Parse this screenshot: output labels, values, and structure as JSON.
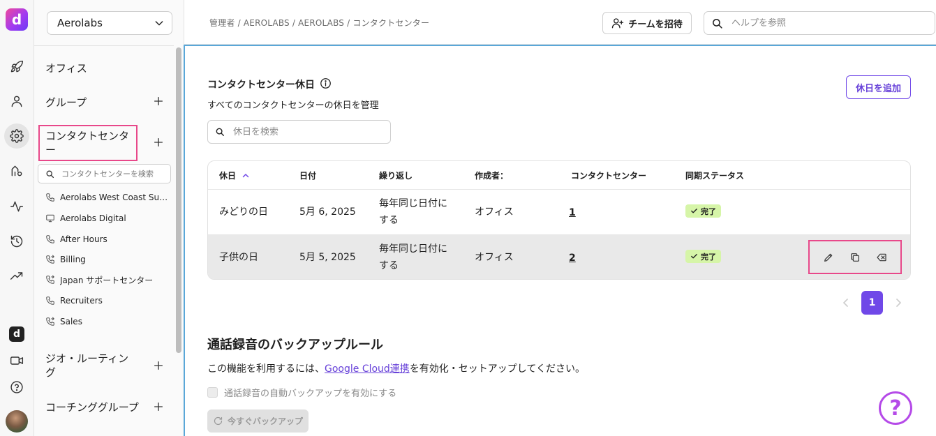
{
  "rail": {
    "logo_letter": "d",
    "badge_letter": "d"
  },
  "sidebar": {
    "company": "Aerolabs",
    "sections": {
      "office": "オフィス",
      "groups": "グループ",
      "contact_center": "コンタクトセンター",
      "geo_routing": "ジオ・ルーティング",
      "coaching": "コーチンググループ"
    },
    "cc_search_placeholder": "コンタクトセンターを検索",
    "cc_items": [
      {
        "label": "Aerolabs West Coast Supp...",
        "icon": "phone-icon"
      },
      {
        "label": "Aerolabs Digital",
        "icon": "monitor-icon"
      },
      {
        "label": "After Hours",
        "icon": "phone-icon"
      },
      {
        "label": "Billing",
        "icon": "phone-forward-icon"
      },
      {
        "label": "Japan サポートセンター",
        "icon": "phone-forward-icon"
      },
      {
        "label": "Recruiters",
        "icon": "phone-icon"
      },
      {
        "label": "Sales",
        "icon": "phone-forward-icon"
      }
    ]
  },
  "header": {
    "breadcrumb": "管理者 / AEROLABS / AEROLABS / コンタクトセンター",
    "invite_label": "チームを招待",
    "help_placeholder": "ヘルプを参照"
  },
  "holidays": {
    "title": "コンタクトセンター休日",
    "subtitle": "すべてのコンタクトセンターの休日を管理",
    "add_label": "休日を追加",
    "search_placeholder": "休日を検索",
    "columns": [
      "休日",
      "日付",
      "繰り返し",
      "作成者：",
      "コンタクトセンター",
      "同期ステータス"
    ],
    "rows": [
      {
        "name": "みどりの日",
        "date": "5月 6, 2025",
        "repeat_line1": "毎年同じ日付に",
        "repeat_line2": "する",
        "creator": "オフィス",
        "count": "1",
        "status": "完了"
      },
      {
        "name": "子供の日",
        "date": "5月 5, 2025",
        "repeat_line1": "毎年同じ日付に",
        "repeat_line2": "する",
        "creator": "オフィス",
        "count": "2",
        "status": "完了"
      }
    ],
    "current_page": "1"
  },
  "backup": {
    "title": "通話録音のバックアップルール",
    "text_before": "この機能を利用するには、",
    "link": "Google Cloud連携",
    "text_after": "を有効化・セットアップしてください。",
    "checkbox_label": "通話録音の自動バックアップを有効にする",
    "button_label": "今すぐバックアップ"
  },
  "help_fab": "?",
  "colors": {
    "accent": "#7048e8",
    "highlight_box": "#e8488a",
    "status_badge": "#d6f5a8",
    "main_border": "#5aa7d8"
  }
}
